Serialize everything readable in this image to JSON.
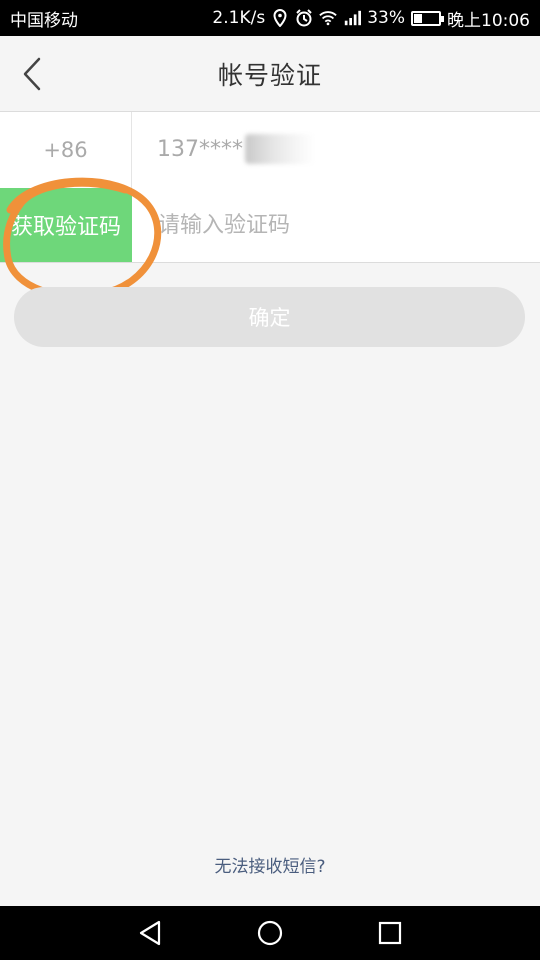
{
  "status_bar": {
    "carrier": "中国移动",
    "net_speed": "2.1K/s",
    "battery": "33%",
    "battery_level": 0.33,
    "time": "晚上10:06",
    "icons": [
      "location-icon",
      "alarm-icon",
      "wifi-icon",
      "signal-icon",
      "battery-icon"
    ]
  },
  "header": {
    "title": "帐号验证",
    "back_icon": "chevron-left-icon"
  },
  "form": {
    "country_code": "+86",
    "phone_masked": "137****",
    "get_code_label": "获取验证码",
    "code_placeholder": "请输入验证码",
    "code_value": ""
  },
  "confirm": {
    "label": "确定"
  },
  "footer": {
    "sms_help": "无法接收短信?"
  },
  "colors": {
    "accent_green": "#6ed77a",
    "annotation_orange": "#f0913a",
    "link_blue": "#4a5d7e",
    "disabled_gray": "#e1e1e1"
  },
  "nav": {
    "icons": [
      "back-triangle-icon",
      "home-circle-icon",
      "recents-square-icon"
    ]
  }
}
